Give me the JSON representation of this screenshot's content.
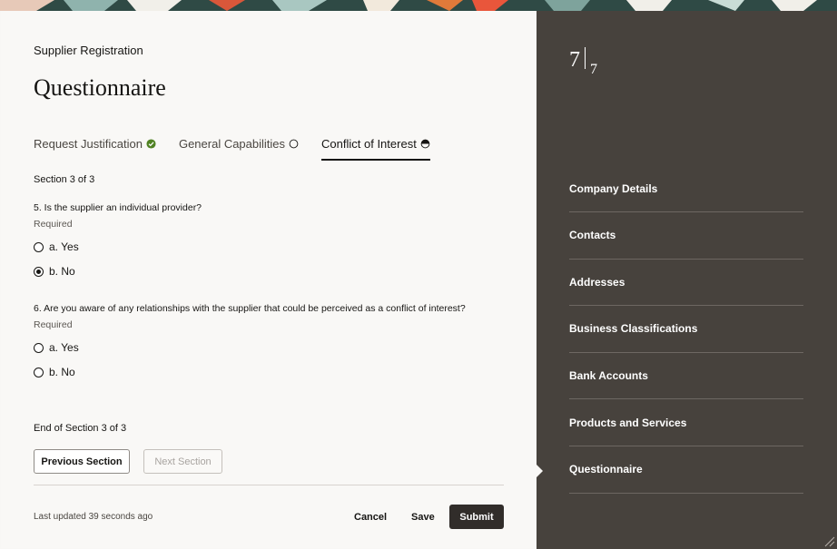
{
  "header": {
    "eyebrow": "Supplier Registration",
    "title": "Questionnaire"
  },
  "tabs": [
    {
      "label": "Request Justification",
      "status": "complete",
      "status_icon": "check-circle-icon"
    },
    {
      "label": "General Capabilities",
      "status": "not-started",
      "status_icon": "empty-circle-icon"
    },
    {
      "label": "Conflict of Interest",
      "status": "in-progress",
      "status_icon": "half-circle-icon",
      "active": true
    }
  ],
  "section": {
    "label": "Section 3 of 3",
    "end_label": "End of Section 3 of 3"
  },
  "questions": [
    {
      "text": "5. Is the supplier an individual provider?",
      "required": "Required",
      "options": [
        {
          "label": "a. Yes",
          "selected": false
        },
        {
          "label": "b. No",
          "selected": true
        }
      ]
    },
    {
      "text": "6. Are you aware of any relationships with the supplier that could be perceived as a conflict of interest?",
      "required": "Required",
      "options": [
        {
          "label": "a. Yes",
          "selected": false
        },
        {
          "label": "b. No",
          "selected": false
        }
      ]
    }
  ],
  "buttons": {
    "previous": "Previous Section",
    "next": "Next Section",
    "cancel": "Cancel",
    "save": "Save",
    "submit": "Submit"
  },
  "footer": {
    "last_updated": "Last updated 39 seconds ago"
  },
  "progress": {
    "current": "7",
    "total": "7"
  },
  "nav": {
    "items": [
      {
        "label": "Company Details"
      },
      {
        "label": "Contacts"
      },
      {
        "label": "Addresses"
      },
      {
        "label": "Business Classifications"
      },
      {
        "label": "Bank Accounts"
      },
      {
        "label": "Products and Services"
      },
      {
        "label": "Questionnaire",
        "active": true
      }
    ]
  },
  "colors": {
    "side_panel": "#47423d",
    "submit_bg": "#312d2a",
    "check_green": "#508223"
  }
}
